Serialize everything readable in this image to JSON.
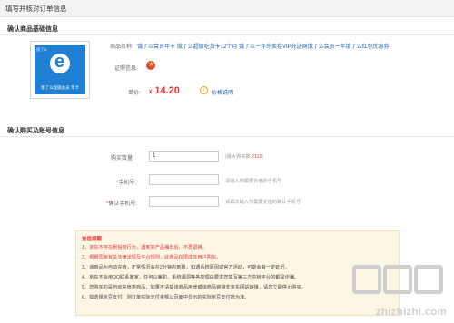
{
  "header": {
    "title": "填写并核对订单信息"
  },
  "product_section": {
    "title": "确认商品基础信息",
    "logo": {
      "brand": "饿了么",
      "caption": "饿了么超级会员 年卡"
    },
    "name_label": "商品名称:",
    "name_value": "饿了么会员年卡 饿了么超级吃货卡12个月 饿了么一年外卖卷VIP充送网饿了么会员一年饿了么红包优惠券",
    "cert_label": "证照信息:",
    "price_label": "单价:",
    "price_currency": "¥",
    "price_value": "14.20",
    "price_info": "价格说明"
  },
  "order_section": {
    "title": "确认购买及账号信息",
    "qty_label": "购买数量:",
    "qty_value": "1",
    "qty_hint": "(最大购买数:2112)",
    "phone_label": "手机号:",
    "phone_hint": "请输入你需要充值的手机号",
    "phone_confirm_label": "确认手机号:",
    "phone_confirm_hint": "请再次输入你需要充值的确认手机号",
    "required_mark": "*"
  },
  "notice": {
    "title": "充值提醒",
    "lines": [
      "1、京东不存在刷信誉行为，遇到类产品兼出后，不再退换。",
      "2、根据国家有关法律法规及平台规则，此商品仅限成年用户购买。",
      "3、该商品为自动充值，正常情况会在2分钟内到账，如遇系统原因或官方活动，可能会有一定延迟。",
      "4、京东不会用QQ联系客家，任何以兼职、系统漏洞等各类理由要求您填写第三方中转平台的都是诈骗。",
      "5、您购买的是自动充值类商品，如果不清楚该商品用途或该商品链接非京东网站链接，请您立即停止购买。",
      "6、如选择京豆支付，则订单实际支付金额以页面中显示的实际京豆支付数为准。"
    ]
  },
  "watermark": {
    "text": "zhizhizhi.com"
  }
}
